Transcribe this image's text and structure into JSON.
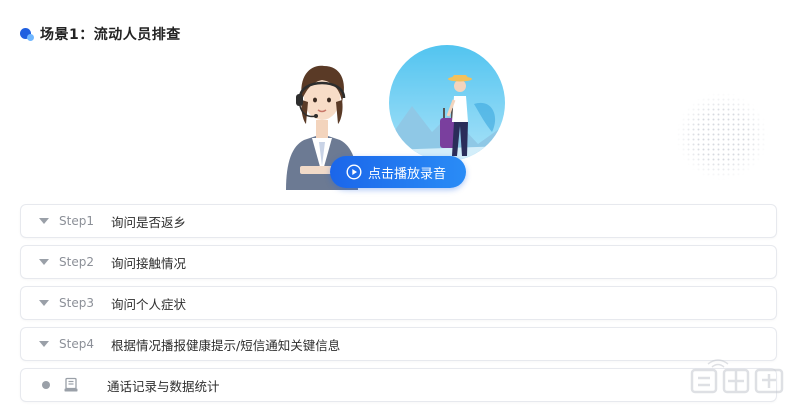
{
  "header": {
    "title": "场景1：流动人员排查"
  },
  "hero": {
    "play_label": "点击播放录音"
  },
  "steps": [
    {
      "num": "Step1",
      "text": "询问是否返乡"
    },
    {
      "num": "Step2",
      "text": "询问接触情况"
    },
    {
      "num": "Step3",
      "text": "询问个人症状"
    },
    {
      "num": "Step4",
      "text": "根据情况播报健康提示/短信通知关键信息"
    }
  ],
  "final_item": {
    "text": "通话记录与数据统计"
  },
  "colors": {
    "accent": "#1f5fe0",
    "accent_light": "#6fb6ff",
    "button_start": "#1b66ea",
    "button_end": "#2a8cf6"
  }
}
